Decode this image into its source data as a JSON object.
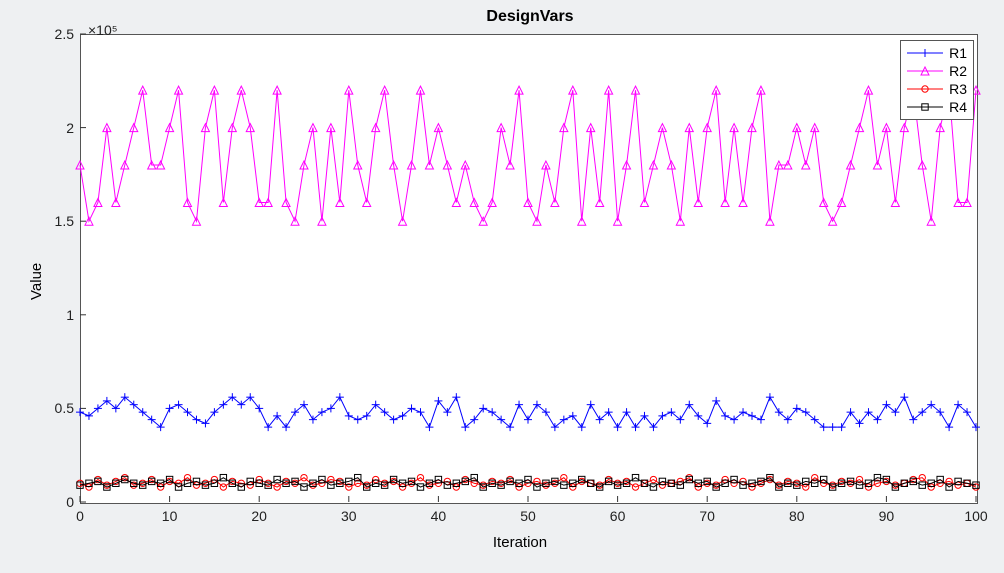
{
  "chart_data": {
    "type": "line",
    "title": "DesignVars",
    "xlabel": "Iteration",
    "ylabel": "Value",
    "y_exponent_label": "×10⁵",
    "xlim": [
      0,
      100
    ],
    "ylim": [
      0,
      2.5
    ],
    "y_scale": 100000,
    "xticks": [
      0,
      10,
      20,
      30,
      40,
      50,
      60,
      70,
      80,
      90,
      100
    ],
    "yticks": [
      0,
      0.5,
      1,
      1.5,
      2,
      2.5
    ],
    "legend": [
      "R1",
      "R2",
      "R3",
      "R4"
    ],
    "x": [
      0,
      1,
      2,
      3,
      4,
      5,
      6,
      7,
      8,
      9,
      10,
      11,
      12,
      13,
      14,
      15,
      16,
      17,
      18,
      19,
      20,
      21,
      22,
      23,
      24,
      25,
      26,
      27,
      28,
      29,
      30,
      31,
      32,
      33,
      34,
      35,
      36,
      37,
      38,
      39,
      40,
      41,
      42,
      43,
      44,
      45,
      46,
      47,
      48,
      49,
      50,
      51,
      52,
      53,
      54,
      55,
      56,
      57,
      58,
      59,
      60,
      61,
      62,
      63,
      64,
      65,
      66,
      67,
      68,
      69,
      70,
      71,
      72,
      73,
      74,
      75,
      76,
      77,
      78,
      79,
      80,
      81,
      82,
      83,
      84,
      85,
      86,
      87,
      88,
      89,
      90,
      91,
      92,
      93,
      94,
      95,
      96,
      97,
      98,
      99,
      100
    ],
    "series": [
      {
        "name": "R1",
        "color": "#0000ff",
        "marker": "plus",
        "values": [
          0.48,
          0.46,
          0.5,
          0.54,
          0.5,
          0.56,
          0.52,
          0.48,
          0.44,
          0.4,
          0.5,
          0.52,
          0.48,
          0.44,
          0.42,
          0.48,
          0.52,
          0.56,
          0.52,
          0.56,
          0.5,
          0.4,
          0.46,
          0.4,
          0.48,
          0.52,
          0.44,
          0.48,
          0.5,
          0.56,
          0.46,
          0.44,
          0.46,
          0.52,
          0.48,
          0.44,
          0.46,
          0.5,
          0.48,
          0.4,
          0.54,
          0.48,
          0.56,
          0.4,
          0.44,
          0.5,
          0.48,
          0.44,
          0.4,
          0.52,
          0.44,
          0.52,
          0.48,
          0.4,
          0.44,
          0.46,
          0.4,
          0.52,
          0.44,
          0.48,
          0.4,
          0.48,
          0.4,
          0.46,
          0.4,
          0.46,
          0.48,
          0.44,
          0.52,
          0.46,
          0.42,
          0.54,
          0.46,
          0.44,
          0.48,
          0.46,
          0.44,
          0.56,
          0.48,
          0.44,
          0.5,
          0.48,
          0.44,
          0.4,
          0.4,
          0.4,
          0.48,
          0.42,
          0.48,
          0.44,
          0.52,
          0.48,
          0.56,
          0.44,
          0.48,
          0.52,
          0.48,
          0.4,
          0.52,
          0.48,
          0.4
        ]
      },
      {
        "name": "R2",
        "color": "#ff00ff",
        "marker": "triangle",
        "values": [
          1.8,
          1.5,
          1.6,
          2.0,
          1.6,
          1.8,
          2.0,
          2.2,
          1.8,
          1.8,
          2.0,
          2.2,
          1.6,
          1.5,
          2.0,
          2.2,
          1.6,
          2.0,
          2.2,
          2.0,
          1.6,
          1.6,
          2.2,
          1.6,
          1.5,
          1.8,
          2.0,
          1.5,
          2.0,
          1.6,
          2.2,
          1.8,
          1.6,
          2.0,
          2.2,
          1.8,
          1.5,
          1.8,
          2.2,
          1.8,
          2.0,
          1.8,
          1.6,
          1.8,
          1.6,
          1.5,
          1.6,
          2.0,
          1.8,
          2.2,
          1.6,
          1.5,
          1.8,
          1.6,
          2.0,
          2.2,
          1.5,
          2.0,
          1.6,
          2.2,
          1.5,
          1.8,
          2.2,
          1.6,
          1.8,
          2.0,
          1.8,
          1.5,
          2.0,
          1.6,
          2.0,
          2.2,
          1.6,
          2.0,
          1.6,
          2.0,
          2.2,
          1.5,
          1.8,
          1.8,
          2.0,
          1.8,
          2.0,
          1.6,
          1.5,
          1.6,
          1.8,
          2.0,
          2.2,
          1.8,
          2.0,
          1.6,
          2.0,
          2.2,
          1.8,
          1.5,
          2.0,
          2.2,
          1.6,
          1.6,
          2.2
        ]
      },
      {
        "name": "R3",
        "color": "#ff0000",
        "marker": "circle",
        "values": [
          0.1,
          0.08,
          0.12,
          0.09,
          0.11,
          0.13,
          0.09,
          0.1,
          0.12,
          0.08,
          0.11,
          0.1,
          0.13,
          0.09,
          0.1,
          0.12,
          0.08,
          0.11,
          0.1,
          0.09,
          0.12,
          0.1,
          0.08,
          0.11,
          0.1,
          0.13,
          0.09,
          0.1,
          0.12,
          0.11,
          0.08,
          0.1,
          0.09,
          0.12,
          0.1,
          0.11,
          0.08,
          0.1,
          0.13,
          0.09,
          0.1,
          0.11,
          0.08,
          0.12,
          0.1,
          0.09,
          0.11,
          0.1,
          0.12,
          0.08,
          0.1,
          0.11,
          0.09,
          0.1,
          0.13,
          0.08,
          0.11,
          0.1,
          0.09,
          0.12,
          0.1,
          0.11,
          0.08,
          0.1,
          0.12,
          0.09,
          0.1,
          0.11,
          0.13,
          0.08,
          0.1,
          0.09,
          0.12,
          0.1,
          0.11,
          0.08,
          0.1,
          0.12,
          0.09,
          0.11,
          0.1,
          0.08,
          0.13,
          0.1,
          0.09,
          0.11,
          0.1,
          0.12,
          0.08,
          0.1,
          0.11,
          0.09,
          0.1,
          0.12,
          0.13,
          0.08,
          0.1,
          0.11,
          0.09,
          0.1,
          0.08
        ]
      },
      {
        "name": "R4",
        "color": "#000000",
        "marker": "square",
        "values": [
          0.09,
          0.1,
          0.11,
          0.08,
          0.1,
          0.12,
          0.1,
          0.09,
          0.11,
          0.1,
          0.12,
          0.08,
          0.1,
          0.11,
          0.09,
          0.1,
          0.13,
          0.1,
          0.08,
          0.11,
          0.1,
          0.09,
          0.12,
          0.1,
          0.11,
          0.08,
          0.1,
          0.12,
          0.09,
          0.1,
          0.11,
          0.13,
          0.08,
          0.1,
          0.09,
          0.12,
          0.1,
          0.11,
          0.08,
          0.1,
          0.12,
          0.09,
          0.1,
          0.11,
          0.13,
          0.08,
          0.1,
          0.09,
          0.11,
          0.1,
          0.12,
          0.08,
          0.1,
          0.11,
          0.09,
          0.1,
          0.12,
          0.1,
          0.08,
          0.11,
          0.09,
          0.1,
          0.13,
          0.1,
          0.08,
          0.11,
          0.1,
          0.09,
          0.12,
          0.1,
          0.11,
          0.08,
          0.1,
          0.12,
          0.09,
          0.1,
          0.11,
          0.13,
          0.08,
          0.1,
          0.09,
          0.11,
          0.1,
          0.12,
          0.08,
          0.1,
          0.11,
          0.09,
          0.1,
          0.13,
          0.12,
          0.08,
          0.1,
          0.11,
          0.09,
          0.1,
          0.12,
          0.08,
          0.11,
          0.1,
          0.09
        ]
      }
    ]
  }
}
